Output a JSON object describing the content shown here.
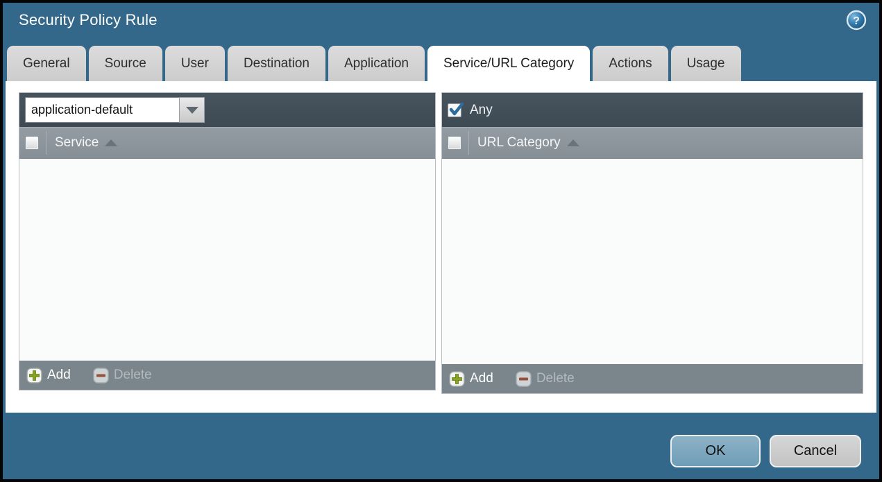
{
  "dialog": {
    "title": "Security Policy Rule"
  },
  "tabs": [
    {
      "label": "General",
      "active": false
    },
    {
      "label": "Source",
      "active": false
    },
    {
      "label": "User",
      "active": false
    },
    {
      "label": "Destination",
      "active": false
    },
    {
      "label": "Application",
      "active": false
    },
    {
      "label": "Service/URL Category",
      "active": true
    },
    {
      "label": "Actions",
      "active": false
    },
    {
      "label": "Usage",
      "active": false
    }
  ],
  "panels": {
    "service": {
      "dropdown_value": "application-default",
      "column_header": "Service",
      "column_sorted": "asc",
      "checkbox_checked": false,
      "rows": [],
      "add_label": "Add",
      "delete_label": "Delete",
      "delete_enabled": false
    },
    "url_category": {
      "any_label": "Any",
      "any_checked": true,
      "column_header": "URL Category",
      "column_sorted": "asc",
      "checkbox_checked": false,
      "rows": [],
      "add_label": "Add",
      "delete_label": "Delete",
      "delete_enabled": false
    }
  },
  "footer": {
    "ok_label": "OK",
    "cancel_label": "Cancel"
  },
  "icons": {
    "help": "question-mark-circle",
    "add": "green-plus",
    "delete": "red-minus",
    "dropdown": "chevron-down-triangle",
    "sort": "triangle-up"
  },
  "colors": {
    "dialog_background": "#33688a",
    "titlebar_text": "#ffffff",
    "dark_toolbar": "#42505a",
    "table_header": "#8d959c",
    "footer_bar": "#7b858c",
    "list_background": "#fafbfb",
    "tab_inactive": "#d4d4d4",
    "tab_active": "#ffffff",
    "ok_button": "#7aa6be",
    "cancel_button": "#cbcccd",
    "add_plus": "#85a321",
    "delete_minus": "#95503c",
    "check_mark": "#2d6d9e"
  }
}
